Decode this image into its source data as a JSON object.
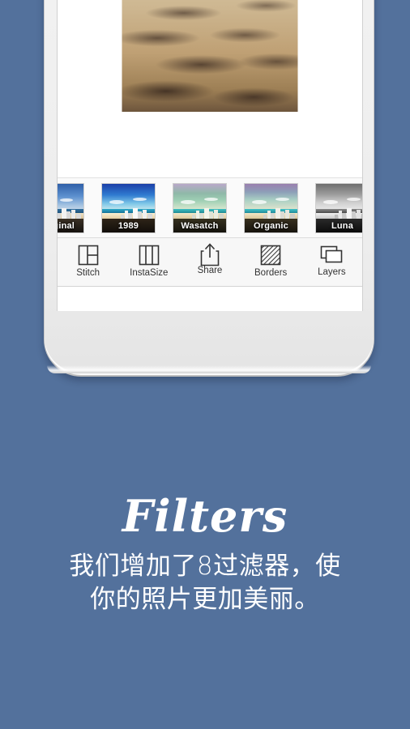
{
  "page": {
    "background_color": "#53719c",
    "text_color": "#ffffff"
  },
  "device": {
    "screen_background": "#ffffff"
  },
  "photo": {
    "alt": "beach-sand-dunes-with-rainbow-umbrella-and-city-skyline"
  },
  "filters": {
    "items": [
      {
        "label": "Original",
        "accent": "#3a6fb0"
      },
      {
        "label": "1989",
        "accent": "#2b63c4"
      },
      {
        "label": "Wasatch",
        "accent": "#79b39a"
      },
      {
        "label": "Organic",
        "accent": "#8a6f9e"
      },
      {
        "label": "Luna",
        "accent": "#8f8f8f"
      }
    ]
  },
  "toolbar": {
    "items": [
      {
        "label": "Stitch",
        "icon": "stitch-icon"
      },
      {
        "label": "InstaSize",
        "icon": "instasize-icon"
      },
      {
        "label": "Share",
        "icon": "share-icon"
      },
      {
        "label": "Borders",
        "icon": "borders-icon"
      },
      {
        "label": "Layers",
        "icon": "layers-icon"
      }
    ]
  },
  "caption": {
    "title": "Filters",
    "line1": "我们增加了8过滤器，使",
    "line2": "你的照片更加美丽。"
  }
}
